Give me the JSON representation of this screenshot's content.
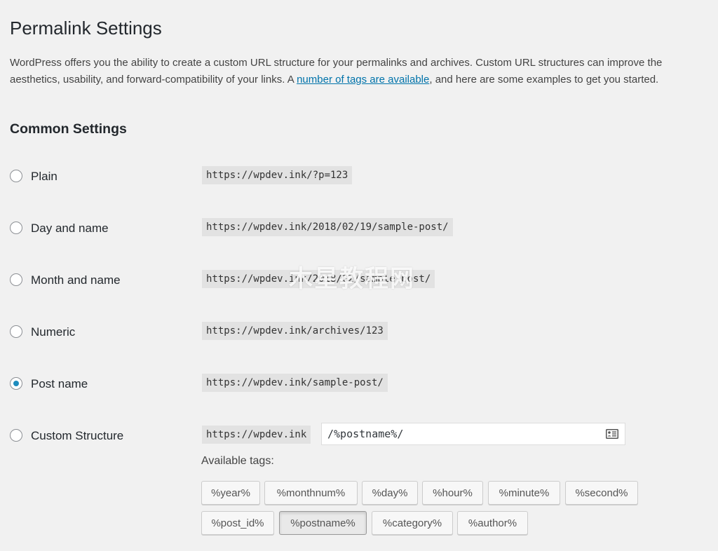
{
  "page": {
    "title": "Permalink Settings",
    "intro_before_link": "WordPress offers you the ability to create a custom URL structure for your permalinks and archives. Custom URL structures can improve the aesthetics, usability, and forward-compatibility of your links. A ",
    "intro_link": "number of tags are available",
    "intro_after_link": ", and here are some examples to get you started.",
    "section_title": "Common Settings"
  },
  "options": [
    {
      "label": "Plain",
      "example": "https://wpdev.ink/?p=123",
      "checked": false
    },
    {
      "label": "Day and name",
      "example": "https://wpdev.ink/2018/02/19/sample-post/",
      "checked": false
    },
    {
      "label": "Month and name",
      "example": "https://wpdev.ink/2018/02/sample-post/",
      "checked": false
    },
    {
      "label": "Numeric",
      "example": "https://wpdev.ink/archives/123",
      "checked": false
    },
    {
      "label": "Post name",
      "example": "https://wpdev.ink/sample-post/",
      "checked": true
    },
    {
      "label": "Custom Structure",
      "example": "https://wpdev.ink",
      "checked": false
    }
  ],
  "custom_structure": {
    "value": "/%postname%/",
    "icon": "id-card-icon"
  },
  "available_tags": {
    "label": "Available tags:",
    "tags": [
      "%year%",
      "%monthnum%",
      "%day%",
      "%hour%",
      "%minute%",
      "%second%",
      "%post_id%",
      "%postname%",
      "%category%",
      "%author%"
    ],
    "active": "%postname%"
  },
  "watermark": "木星教程网",
  "colors": {
    "link": "#0073aa",
    "radio_checked": "#1e8cbe",
    "background": "#f1f1f1"
  }
}
